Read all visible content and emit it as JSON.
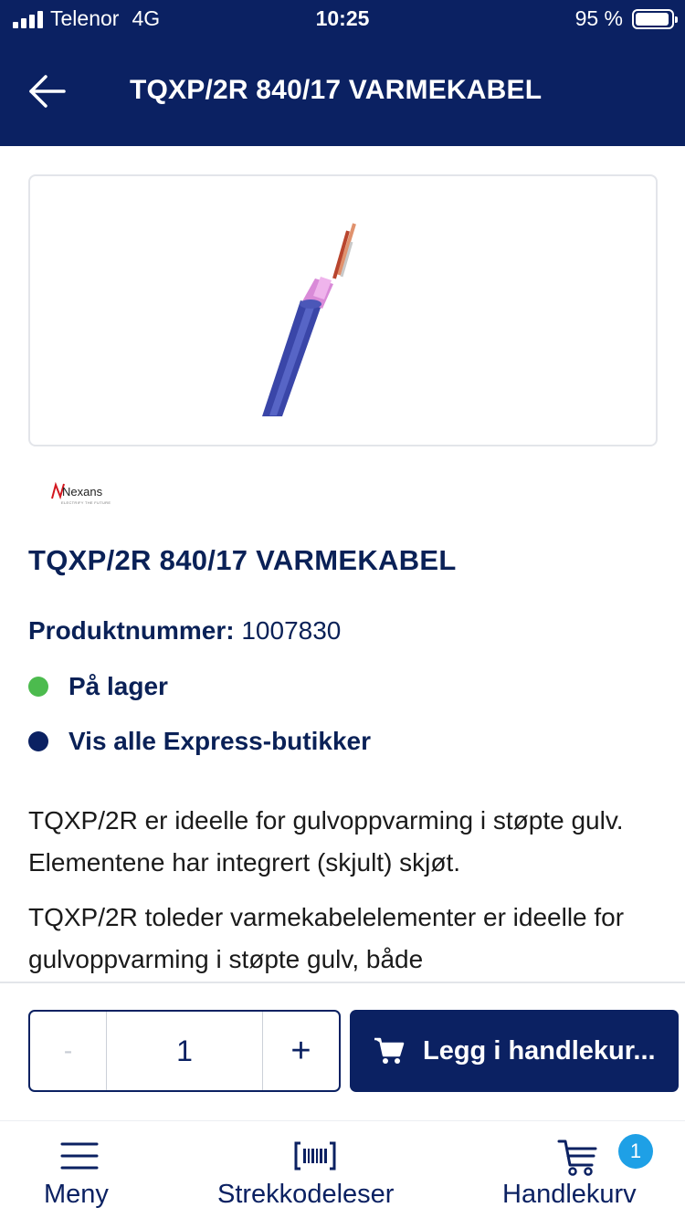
{
  "status_bar": {
    "carrier": "Telenor",
    "network": "4G",
    "time": "10:25",
    "battery": "95 %"
  },
  "header": {
    "back_icon": "arrow-left-icon",
    "title": "TQXP/2R 840/17 VARMEKABEL"
  },
  "product": {
    "image": "heating-cable-photo",
    "brand": {
      "name": "Nexans",
      "tagline": "ELECTRIFY THE FUTURE",
      "color": "#d3171f"
    },
    "title": "TQXP/2R 840/17 VARMEKABEL",
    "sku_label": "Produktnummer:",
    "sku_value": "1007830",
    "stock": {
      "label": "På lager",
      "color": "#4cbb4e"
    },
    "express": {
      "label": "Vis alle Express-butikker",
      "color": "#0b2162"
    },
    "description": [
      "TQXP/2R er ideelle for gulvoppvarming i støpte gulv. Elementene har integrert (skjult) skjøt.",
      "TQXP/2R toleder varmekabelelementer er ideelle for gulvoppvarming i støpte gulv, både"
    ]
  },
  "purchase": {
    "minus": "-",
    "quantity": "1",
    "plus": "+",
    "cart_icon": "shopping-cart-icon",
    "add_to_cart": "Legg i handlekur..."
  },
  "tabbar": {
    "menu": {
      "label": "Meny",
      "icon": "hamburger-icon"
    },
    "scanner": {
      "label": "Strekkodeleser",
      "icon": "barcode-icon"
    },
    "cart": {
      "label": "Handlekurv",
      "icon": "cart-icon",
      "badge": "1"
    }
  },
  "colors": {
    "primary": "#0b2162",
    "badge": "#1ea0e6",
    "in_stock": "#4cbb4e"
  }
}
